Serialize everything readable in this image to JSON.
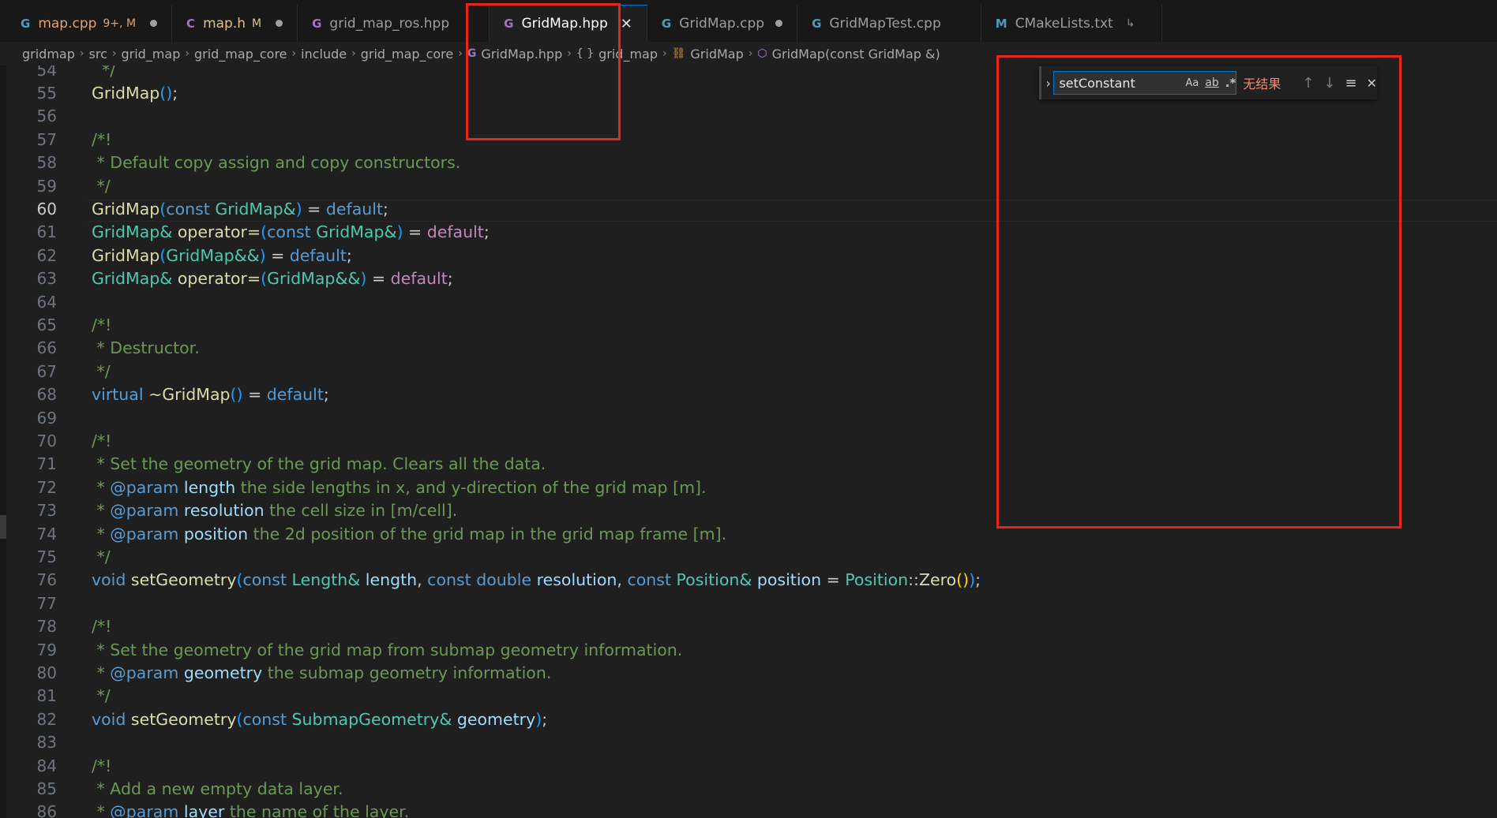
{
  "tabs": [
    {
      "icon": "G",
      "icon_color": "#519aba",
      "label": "map.cpp",
      "status": "9+, M",
      "label_color": "#e2a170",
      "modified": true
    },
    {
      "icon": "C",
      "icon_color": "#a074c4",
      "label": "map.h",
      "status": "M",
      "label_color": "#e2c08d",
      "modified": true
    },
    {
      "icon": "G",
      "icon_color": "#a074c4",
      "label": "grid_map_ros.hpp",
      "status": "",
      "label_color": "#9d9d9d",
      "modified": false
    },
    {
      "icon": "G",
      "icon_color": "#a074c4",
      "label": "GridMap.hpp",
      "status": "",
      "label_color": "#ffffff",
      "modified": false,
      "active": true
    },
    {
      "icon": "G",
      "icon_color": "#519aba",
      "label": "GridMap.cpp",
      "status": "",
      "label_color": "#9d9d9d",
      "modified": true
    },
    {
      "icon": "G",
      "icon_color": "#519aba",
      "label": "GridMapTest.cpp",
      "status": "",
      "label_color": "#9d9d9d",
      "modified": false
    },
    {
      "icon": "M",
      "icon_color": "#519aba",
      "label": "CMakeLists.txt",
      "status": "",
      "label_color": "#9d9d9d",
      "modified": false,
      "follow": "↳"
    }
  ],
  "breadcrumb": {
    "items": [
      "gridmap",
      "src",
      "grid_map",
      "grid_map_core",
      "include",
      "grid_map_core"
    ],
    "file": "GridMap.hpp",
    "namespace_icon": "{ }",
    "namespace": "grid_map",
    "class": "GridMap",
    "member": "GridMap(const GridMap &)"
  },
  "editor": {
    "current_line": "60",
    "lines": [
      {
        "n": "54",
        "html": "  <span class='cmt'>*/</span>"
      },
      {
        "n": "55",
        "html": "<span class='fn'>GridMap</span><span class='par'>()</span>;"
      },
      {
        "n": "56",
        "html": ""
      },
      {
        "n": "57",
        "html": "<span class='cmt'>/*!</span>"
      },
      {
        "n": "58",
        "html": "<span class='cmt'> * Default copy assign and copy constructors.</span>"
      },
      {
        "n": "59",
        "html": "<span class='cmt'> */</span>"
      },
      {
        "n": "60",
        "html": "<span class='fn'>GridMap</span><span class='par'>(</span><span class='kw'>const</span> <span class='typ'>GridMap&amp;</span><span class='par'>)</span> = <span class='kw'>default</span>;"
      },
      {
        "n": "61",
        "html": "<span class='typ'>GridMap&amp;</span> <span class='fn'>operator=</span><span class='par'>(</span><span class='kw'>const</span> <span class='typ'>GridMap&amp;</span><span class='par'>)</span> = <span class='kw2'>default</span>;"
      },
      {
        "n": "62",
        "html": "<span class='fn'>GridMap</span><span class='par'>(</span><span class='typ'>GridMap&amp;&amp;</span><span class='par'>)</span> = <span class='kw'>default</span>;"
      },
      {
        "n": "63",
        "html": "<span class='typ'>GridMap&amp;</span> <span class='fn'>operator=</span><span class='par'>(</span><span class='typ'>GridMap&amp;&amp;</span><span class='par'>)</span> = <span class='kw2'>default</span>;"
      },
      {
        "n": "64",
        "html": ""
      },
      {
        "n": "65",
        "html": "<span class='cmt'>/*!</span>"
      },
      {
        "n": "66",
        "html": "<span class='cmt'> * Destructor.</span>"
      },
      {
        "n": "67",
        "html": "<span class='cmt'> */</span>"
      },
      {
        "n": "68",
        "html": "<span class='kw'>virtual</span> <span class='fn'>~GridMap</span><span class='par'>()</span> = <span class='kw'>default</span>;"
      },
      {
        "n": "69",
        "html": ""
      },
      {
        "n": "70",
        "html": "<span class='cmt'>/*!</span>"
      },
      {
        "n": "71",
        "html": "<span class='cmt'> * Set the geometry of the grid map. Clears all the data.</span>"
      },
      {
        "n": "72",
        "html": "<span class='cmt'> * </span><span class='tag'>@param</span> <span class='var'>length</span><span class='cmt'> the side lengths in x, and y-direction of the grid map [m].</span>"
      },
      {
        "n": "73",
        "html": "<span class='cmt'> * </span><span class='tag'>@param</span> <span class='var'>resolution</span><span class='cmt'> the cell size in [m/cell].</span>"
      },
      {
        "n": "74",
        "html": "<span class='cmt'> * </span><span class='tag'>@param</span> <span class='var'>position</span><span class='cmt'> the 2d position of the grid map in the grid map frame [m].</span>"
      },
      {
        "n": "75",
        "html": "<span class='cmt'> */</span>"
      },
      {
        "n": "76",
        "html": "<span class='kw'>void</span> <span class='fn'>setGeometry</span><span class='par'>(</span><span class='kw'>const</span> <span class='typ'>Length&amp;</span> <span class='var'>length</span>, <span class='kw'>const</span> <span class='kw'>double</span> <span class='var'>resolution</span>, <span class='kw'>const</span> <span class='typ'>Position&amp;</span> <span class='var'>position</span> = <span class='typ'>Position</span>::<span class='fn'>Zero</span><span class='par2'>()</span><span class='par'>)</span>;"
      },
      {
        "n": "77",
        "html": ""
      },
      {
        "n": "78",
        "html": "<span class='cmt'>/*!</span>"
      },
      {
        "n": "79",
        "html": "<span class='cmt'> * Set the geometry of the grid map from submap geometry information.</span>"
      },
      {
        "n": "80",
        "html": "<span class='cmt'> * </span><span class='tag'>@param</span> <span class='var'>geometry</span><span class='cmt'> the submap geometry information.</span>"
      },
      {
        "n": "81",
        "html": "<span class='cmt'> */</span>"
      },
      {
        "n": "82",
        "html": "<span class='kw'>void</span> <span class='fn'>setGeometry</span><span class='par'>(</span><span class='kw'>const</span> <span class='typ'>SubmapGeometry&amp;</span> <span class='var'>geometry</span><span class='par'>)</span>;"
      },
      {
        "n": "83",
        "html": ""
      },
      {
        "n": "84",
        "html": "<span class='cmt'>/*!</span>"
      },
      {
        "n": "85",
        "html": "<span class='cmt'> * Add a new empty data layer.</span>"
      },
      {
        "n": "86",
        "html": "<span class='cmt'> * </span><span class='tag'>@param</span> <span class='var'>layer</span><span class='cmt'> the name of the layer.</span>"
      }
    ]
  },
  "find": {
    "query": "setConstant",
    "match_case_label": "Aa",
    "whole_word_label": "ab",
    "regex_label": ".*",
    "result_text": "无结果",
    "prev_icon": "↑",
    "next_icon": "↓",
    "selection_icon": "≡",
    "close_icon": "✕",
    "toggle_icon": "›"
  }
}
